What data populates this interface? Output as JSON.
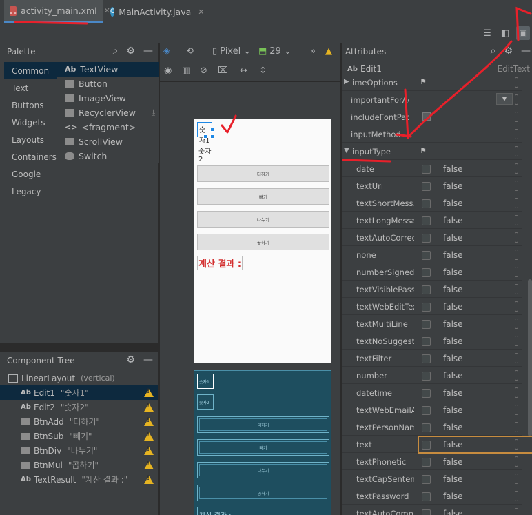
{
  "tabs": [
    {
      "label": "activity_main.xml",
      "icon": "xml-file-icon",
      "active": true
    },
    {
      "label": "MainActivity.java",
      "icon": "java-class-icon",
      "active": false
    }
  ],
  "palette": {
    "title": "Palette",
    "categories": [
      "Common",
      "Text",
      "Buttons",
      "Widgets",
      "Layouts",
      "Containers",
      "Google",
      "Legacy"
    ],
    "items": [
      {
        "label": "TextView",
        "prefix": "Ab"
      },
      {
        "label": "Button"
      },
      {
        "label": "ImageView"
      },
      {
        "label": "RecyclerView"
      },
      {
        "label": "<fragment>",
        "prefix": "<>"
      },
      {
        "label": "ScrollView"
      },
      {
        "label": "Switch"
      }
    ]
  },
  "design_toolbar": {
    "device": "Pixel",
    "api": "29",
    "overflow": "»"
  },
  "phone": {
    "edit1": "숫자1",
    "edit2": "숫자2",
    "btn_add": "더하기",
    "btn_sub": "빼기",
    "btn_div": "나누기",
    "btn_mul": "곱하기",
    "result": "계산 결과 :",
    "blueprint_result": "계산 결과 :"
  },
  "component_tree": {
    "title": "Component Tree",
    "root": {
      "label": "LinearLayout",
      "attr": "(vertical)"
    },
    "nodes": [
      {
        "label": "Edit1",
        "attr": "\"숫자1\"",
        "kind": "text"
      },
      {
        "label": "Edit2",
        "attr": "\"숫자2\"",
        "kind": "text"
      },
      {
        "label": "BtnAdd",
        "attr": "\"더하기\"",
        "kind": "button"
      },
      {
        "label": "BtnSub",
        "attr": "\"빼기\"",
        "kind": "button"
      },
      {
        "label": "BtnDiv",
        "attr": "\"나누기\"",
        "kind": "button"
      },
      {
        "label": "BtnMul",
        "attr": "\"곱하기\"",
        "kind": "button"
      },
      {
        "label": "TextResult",
        "attr": "\"계산 결과 :\"",
        "kind": "text"
      }
    ]
  },
  "attributes": {
    "title": "Attributes",
    "component": "Edit1",
    "component_type": "EditText",
    "rows": [
      {
        "name": "imeOptions",
        "type": "group-collapsed"
      },
      {
        "name": "importantForAcc...",
        "type": "dropdown"
      },
      {
        "name": "includeFontPadd...",
        "type": "checkbox-only"
      },
      {
        "name": "inputMethod",
        "type": "empty"
      },
      {
        "name": "inputType",
        "type": "group-expanded"
      },
      {
        "name": "date",
        "value": "false"
      },
      {
        "name": "textUri",
        "value": "false"
      },
      {
        "name": "textShortMess...",
        "value": "false"
      },
      {
        "name": "textLongMessa...",
        "value": "false"
      },
      {
        "name": "textAutoCorrect",
        "value": "false"
      },
      {
        "name": "none",
        "value": "false"
      },
      {
        "name": "numberSigned",
        "value": "false"
      },
      {
        "name": "textVisiblePass...",
        "value": "false"
      },
      {
        "name": "textWebEditText",
        "value": "false"
      },
      {
        "name": "textMultiLine",
        "value": "false"
      },
      {
        "name": "textNoSuggest...",
        "value": "false"
      },
      {
        "name": "textFilter",
        "value": "false"
      },
      {
        "name": "number",
        "value": "false"
      },
      {
        "name": "datetime",
        "value": "false"
      },
      {
        "name": "textWebEmailA...",
        "value": "false"
      },
      {
        "name": "textPersonName",
        "value": "false"
      },
      {
        "name": "text",
        "value": "false",
        "focused": true
      },
      {
        "name": "textPhonetic",
        "value": "false"
      },
      {
        "name": "textCapSenten...",
        "value": "false"
      },
      {
        "name": "textPassword",
        "value": "false"
      },
      {
        "name": "textAutoCompl...",
        "value": "false"
      }
    ]
  },
  "colors": {
    "annotation": "#e8202a",
    "selection": "#0d293e",
    "warning": "#e6b422",
    "focus": "#c78c3f"
  }
}
